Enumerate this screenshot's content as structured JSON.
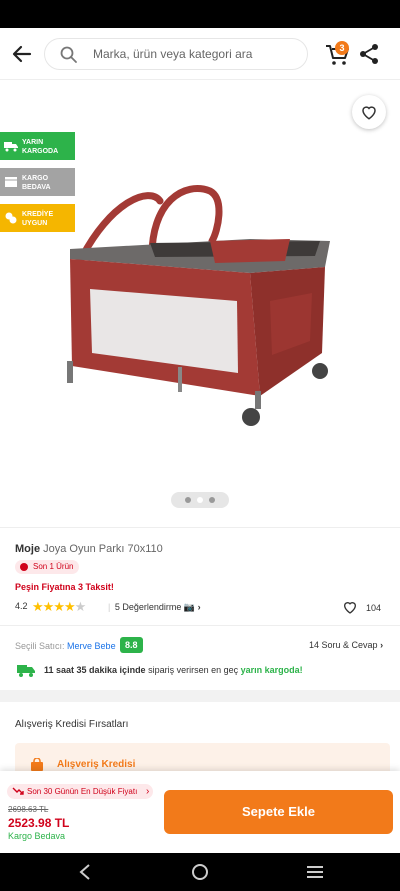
{
  "search": {
    "placeholder": "Marka, ürün veya kategori ara"
  },
  "header": {
    "cart_count": "3"
  },
  "badges": [
    {
      "text": "YARIN KARGODA",
      "color": "#2db34a"
    },
    {
      "text": "KARGO BEDAVA",
      "color": "#a3a3a3"
    },
    {
      "text": "KREDİYE UYGUN",
      "color": "#f5b600"
    }
  ],
  "product": {
    "brand": "Moje",
    "title": "Joya Oyun Parkı 70x110",
    "stock": "Son 1 Ürün",
    "installment": "Peşin Fiyatına 3 Taksit!",
    "rating": "4.2",
    "stars": 4,
    "reviews": "5 Değerlendirme",
    "likes": "104"
  },
  "seller": {
    "label": "Seçili Satıcı:",
    "name": "Merve Bebe",
    "score": "8.8",
    "qa": "14 Soru & Cevap"
  },
  "delivery": {
    "time": "11 saat 35 dakika içinde",
    "middle": "sipariş verirsen en geç",
    "highlight": "yarın kargoda!"
  },
  "credit": {
    "section_title": "Alışveriş Kredisi Fırsatları",
    "label": "Alışveriş Kredisi"
  },
  "bottom": {
    "low_price": "Son 30 Günün En Düşük Fiyatı",
    "old_price": "2698.63 TL",
    "price": "2523.98 TL",
    "free_shipping": "Kargo Bedava",
    "add_to_cart": "Sepete Ekle"
  },
  "colors": {
    "accent": "#f27a1a",
    "price": "#d0021b",
    "green": "#2db34a",
    "product_red": "#a33a35"
  }
}
